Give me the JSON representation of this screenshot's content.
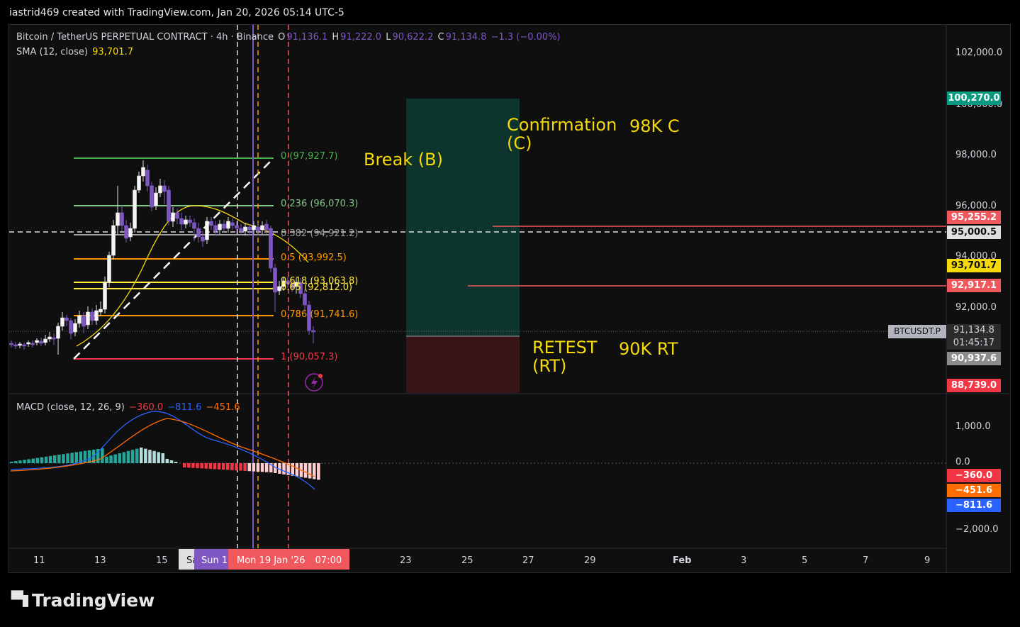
{
  "header": {
    "text": "iastrid469 created with TradingView.com, Jan 20, 2026 05:14 UTC-5"
  },
  "legend": {
    "symbol": "Bitcoin / TetherUS PERPETUAL CONTRACT · 4h · Binance",
    "o_label": "O",
    "o": "91,136.1",
    "h_label": "H",
    "h": "91,222.0",
    "l_label": "L",
    "l": "90,622.2",
    "c_label": "C",
    "c": "91,134.8",
    "change": "−1.3 (−0.00%)",
    "sma_label": "SMA (12, close)",
    "sma_value": "93,701.7"
  },
  "macd": {
    "label": "MACD (close, 12, 26, 9)",
    "hist": "−360.0",
    "macd": "−811.6",
    "signal": "−451.6"
  },
  "price_axis": [
    "102,000.0",
    "98,000.0",
    "96,000.0",
    "94,000.0",
    "92,000.0"
  ],
  "price_axis_partial": "100,000.0",
  "macd_axis": [
    "1,000.0",
    "0.0",
    "−2,000.0"
  ],
  "price_tags": {
    "take_profit": "100,270.0",
    "line1": "95,255.2",
    "dashed": "95,000.5",
    "sma": "93,701.7",
    "line2": "92,917.1",
    "symbol_tag": "BTCUSDT.P",
    "last": "91,134.8",
    "countdown": "01:45:17",
    "entry": "90,937.6",
    "stop": "88,739.0",
    "macd_hist": "−360.0",
    "macd_signal": "−451.6",
    "macd_macd": "−811.6"
  },
  "time_axis": [
    "11",
    "13",
    "15",
    "23",
    "25",
    "27",
    "29",
    "Feb",
    "3",
    "5",
    "7",
    "9"
  ],
  "time_highlights": {
    "sat": "Sa",
    "sun": "Sun 1",
    "mon": "Mon 19 Jan '26",
    "time": "07:00"
  },
  "fib_levels": [
    {
      "text": "0 (97,927.7)",
      "color": "#4caf50"
    },
    {
      "text": "0.236 (96,070.3)",
      "color": "#81c784"
    },
    {
      "text": "0.382 (94,921.2)",
      "color": "#9e9e9e"
    },
    {
      "text": "0.5 (93,992.5)",
      "color": "#ff9800"
    },
    {
      "text": "0.618 (93,063.8)",
      "color": "#ffeb3b"
    },
    {
      "text": "0.65 (92,812.0)",
      "color": "#ffeb3b"
    },
    {
      "text": "0.786 (91,741.6)",
      "color": "#ff9800"
    },
    {
      "text": "1 (90,057.3)",
      "color": "#f23645"
    }
  ],
  "annotations": {
    "break": "Break (B)",
    "confirmation_line1": "Confirmation",
    "confirmation_line2": "(C)",
    "confirmation_short": "98K C",
    "retest_line1": "RETEST",
    "retest_line2": "(RT)",
    "retest_short": "90K RT"
  },
  "brand": {
    "name": "TradingView"
  },
  "colors": {
    "up": "#b2b5be",
    "down": "#7e57c2",
    "green_tag": "#089981",
    "red_tag": "#f23645",
    "yellow": "#f5d90a",
    "purple": "#7e57c2"
  }
}
